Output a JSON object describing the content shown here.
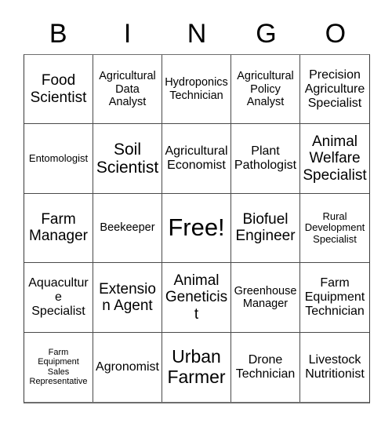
{
  "card": {
    "title": "BINGO",
    "header_letters": [
      "B",
      "I",
      "N",
      "G",
      "O"
    ],
    "columns": 5,
    "rows": 5,
    "free_space_label": "Free!",
    "free_space_index": 12,
    "colors": {
      "background": "#ffffff",
      "text": "#000000",
      "grid_line": "#4a4a4a",
      "outer_border": "#6e6e6e"
    },
    "cells": [
      {
        "text": "Food Scientist",
        "size": "fs-md"
      },
      {
        "text": "Agricultural Data Analyst",
        "size": "fs-xs"
      },
      {
        "text": "Hydroponics Technician",
        "size": "fs-xs"
      },
      {
        "text": "Agricultural Policy Analyst",
        "size": "fs-xs"
      },
      {
        "text": "Precision Agriculture Specialist",
        "size": "fs-sm"
      },
      {
        "text": "Entomologist",
        "size": "fs-xxs"
      },
      {
        "text": "Soil Scientist",
        "size": "fs-lg"
      },
      {
        "text": "Agricultural Economist",
        "size": "fs-sm"
      },
      {
        "text": "Plant Pathologist",
        "size": "fs-sm"
      },
      {
        "text": "Animal Welfare Specialist",
        "size": "fs-md"
      },
      {
        "text": "Farm Manager",
        "size": "fs-md"
      },
      {
        "text": "Beekeeper",
        "size": "fs-xs"
      },
      {
        "text": "Free!",
        "size": "fs-xxl"
      },
      {
        "text": "Biofuel Engineer",
        "size": "fs-md"
      },
      {
        "text": "Rural Development Specialist",
        "size": "fs-xxs"
      },
      {
        "text": "Aquaculture Specialist",
        "size": "fs-sm"
      },
      {
        "text": "Extension Agent",
        "size": "fs-md"
      },
      {
        "text": "Animal Geneticist",
        "size": "fs-md"
      },
      {
        "text": "Greenhouse Manager",
        "size": "fs-xs"
      },
      {
        "text": "Farm Equipment Technician",
        "size": "fs-sm"
      },
      {
        "text": "Farm Equipment Sales Representative",
        "size": "fs-tiny"
      },
      {
        "text": "Agronomist",
        "size": "fs-sm"
      },
      {
        "text": "Urban Farmer",
        "size": "fs-xl"
      },
      {
        "text": "Drone Technician",
        "size": "fs-sm"
      },
      {
        "text": "Livestock Nutritionist",
        "size": "fs-sm"
      }
    ]
  }
}
